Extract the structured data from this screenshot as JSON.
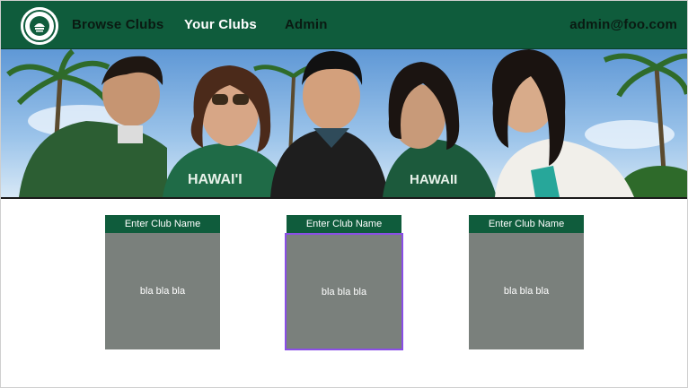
{
  "nav": {
    "brand_logo": "university-seal-logo",
    "links": [
      {
        "label": "Browse Clubs",
        "active": false
      },
      {
        "label": "Your Clubs",
        "active": true
      },
      {
        "label": "Admin",
        "active": false
      }
    ],
    "user_email": "admin@foo.com"
  },
  "carousel": {
    "slide_count": 3,
    "active_index": 1
  },
  "cards": [
    {
      "title": "Enter Club Name",
      "body": "bla bla bla",
      "selected": false
    },
    {
      "title": "Enter Club Name",
      "body": "bla bla bla",
      "selected": true
    },
    {
      "title": "Enter Club Name",
      "body": "bla bla bla",
      "selected": false
    }
  ],
  "colors": {
    "brand_green": "#0f5c3c",
    "card_body": "#7a807c",
    "selection": "#8a4ee6"
  }
}
